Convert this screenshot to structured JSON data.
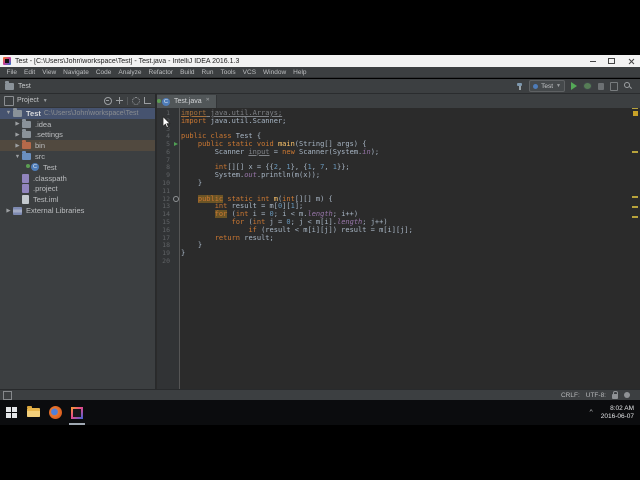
{
  "window": {
    "title": "Test - [C:\\Users\\John\\workspace\\Test] - Test.java - IntelliJ IDEA 2016.1.3"
  },
  "menu": {
    "items": [
      "File",
      "Edit",
      "View",
      "Navigate",
      "Code",
      "Analyze",
      "Refactor",
      "Build",
      "Run",
      "Tools",
      "VCS",
      "Window",
      "Help"
    ]
  },
  "navbar": {
    "breadcrumb": "Test",
    "run_config": "Test"
  },
  "project_panel": {
    "title": "Project",
    "items": [
      {
        "arrow": "expanded",
        "icon": "folder",
        "label": "Test",
        "path": "C:\\Users\\John\\workspace\\Test",
        "indent": 0,
        "selected": true,
        "bold": true
      },
      {
        "arrow": "collapsed",
        "icon": "folder",
        "label": ".idea",
        "indent": 1
      },
      {
        "arrow": "collapsed",
        "icon": "folder",
        "label": ".settings",
        "indent": 1
      },
      {
        "arrow": "collapsed",
        "icon": "folder-excluded",
        "label": "bin",
        "indent": 1,
        "tinted": true
      },
      {
        "arrow": "expanded",
        "icon": "folder-src",
        "label": "src",
        "indent": 1
      },
      {
        "arrow": null,
        "icon": "class",
        "label": "Test",
        "indent": 2
      },
      {
        "arrow": null,
        "icon": "file",
        "label": ".classpath",
        "indent": 1
      },
      {
        "arrow": null,
        "icon": "file",
        "label": ".project",
        "indent": 1
      },
      {
        "arrow": null,
        "icon": "file-iml",
        "label": "Test.iml",
        "indent": 1
      },
      {
        "arrow": "collapsed",
        "icon": "library",
        "label": "External Libraries",
        "indent": 0
      }
    ]
  },
  "editor": {
    "tab_label": "Test.java",
    "lines": [
      {
        "n": 1,
        "s": [
          {
            "c": "ku",
            "t": "import"
          },
          {
            "c": "u",
            "t": " java.util.Arrays;"
          }
        ]
      },
      {
        "n": 2,
        "s": [
          {
            "c": "k",
            "t": "import"
          },
          {
            "c": "p",
            "t": " java.util.Scanner;"
          }
        ]
      },
      {
        "n": 3,
        "s": []
      },
      {
        "n": 4,
        "s": [
          {
            "c": "k",
            "t": "public class"
          },
          {
            "c": "p",
            "t": " Test {"
          }
        ]
      },
      {
        "n": 5,
        "g": "run",
        "s": [
          {
            "c": "p",
            "t": "    "
          },
          {
            "c": "k",
            "t": "public static void"
          },
          {
            "c": "p",
            "t": " "
          },
          {
            "c": "d",
            "t": "main"
          },
          {
            "c": "p",
            "t": "(String[] args) {"
          }
        ]
      },
      {
        "n": 6,
        "s": [
          {
            "c": "p",
            "t": "        Scanner "
          },
          {
            "c": "u",
            "t": "input"
          },
          {
            "c": "p",
            "t": " = "
          },
          {
            "c": "k",
            "t": "new"
          },
          {
            "c": "p",
            "t": " Scanner(System."
          },
          {
            "c": "f",
            "t": "in"
          },
          {
            "c": "p",
            "t": ");"
          }
        ]
      },
      {
        "n": 7,
        "s": []
      },
      {
        "n": 8,
        "s": [
          {
            "c": "p",
            "t": "        "
          },
          {
            "c": "k",
            "t": "int"
          },
          {
            "c": "p",
            "t": "[][] x = {{"
          },
          {
            "c": "n",
            "t": "2"
          },
          {
            "c": "p",
            "t": ", "
          },
          {
            "c": "n",
            "t": "1"
          },
          {
            "c": "p",
            "t": "}, {"
          },
          {
            "c": "n",
            "t": "1"
          },
          {
            "c": "p",
            "t": ", "
          },
          {
            "c": "n",
            "t": "7"
          },
          {
            "c": "p",
            "t": ", "
          },
          {
            "c": "n",
            "t": "1"
          },
          {
            "c": "p",
            "t": "}};"
          }
        ]
      },
      {
        "n": 9,
        "s": [
          {
            "c": "p",
            "t": "        System."
          },
          {
            "c": "f",
            "t": "out"
          },
          {
            "c": "p",
            "t": ".println(m(x));"
          }
        ]
      },
      {
        "n": 10,
        "s": [
          {
            "c": "p",
            "t": "    }"
          }
        ]
      },
      {
        "n": 11,
        "s": []
      },
      {
        "n": 12,
        "g": "target",
        "s": [
          {
            "c": "p",
            "t": "    "
          },
          {
            "c": "khl",
            "t": "public"
          },
          {
            "c": "k",
            "t": " static int "
          },
          {
            "c": "d",
            "t": "m"
          },
          {
            "c": "p",
            "t": "("
          },
          {
            "c": "k",
            "t": "int"
          },
          {
            "c": "p",
            "t": "[][] m) {"
          }
        ]
      },
      {
        "n": 13,
        "s": [
          {
            "c": "p",
            "t": "        "
          },
          {
            "c": "k",
            "t": "int"
          },
          {
            "c": "p",
            "t": " result = m["
          },
          {
            "c": "n",
            "t": "0"
          },
          {
            "c": "p",
            "t": "]["
          },
          {
            "c": "n",
            "t": "1"
          },
          {
            "c": "p",
            "t": "];"
          }
        ]
      },
      {
        "n": 14,
        "s": [
          {
            "c": "p",
            "t": "        "
          },
          {
            "c": "khl",
            "t": "for"
          },
          {
            "c": "p",
            "t": " ("
          },
          {
            "c": "k",
            "t": "int"
          },
          {
            "c": "p",
            "t": " i = "
          },
          {
            "c": "n",
            "t": "0"
          },
          {
            "c": "p",
            "t": "; i < m."
          },
          {
            "c": "f",
            "t": "length"
          },
          {
            "c": "p",
            "t": "; i++)"
          }
        ]
      },
      {
        "n": 15,
        "s": [
          {
            "c": "p",
            "t": "            "
          },
          {
            "c": "k",
            "t": "for"
          },
          {
            "c": "p",
            "t": " ("
          },
          {
            "c": "k",
            "t": "int"
          },
          {
            "c": "p",
            "t": " j = "
          },
          {
            "c": "n",
            "t": "0"
          },
          {
            "c": "p",
            "t": "; j < m[i]."
          },
          {
            "c": "f",
            "t": "length"
          },
          {
            "c": "p",
            "t": "; j++)"
          }
        ]
      },
      {
        "n": 16,
        "s": [
          {
            "c": "p",
            "t": "                "
          },
          {
            "c": "k",
            "t": "if"
          },
          {
            "c": "p",
            "t": " (result < m[i][j]) result = m[i][j];"
          }
        ]
      },
      {
        "n": 17,
        "s": [
          {
            "c": "p",
            "t": "        "
          },
          {
            "c": "k",
            "t": "return"
          },
          {
            "c": "p",
            "t": " result;"
          }
        ]
      },
      {
        "n": 18,
        "s": [
          {
            "c": "p",
            "t": "    }"
          }
        ]
      },
      {
        "n": 19,
        "s": [
          {
            "c": "p",
            "t": "}"
          }
        ]
      },
      {
        "n": 20,
        "s": []
      }
    ]
  },
  "status_bar": {
    "line_ending": "CRLF:",
    "encoding": "UTF-8:"
  },
  "taskbar": {
    "time": "8:02 AM",
    "date": "2016-06-07",
    "tray_expand": "^"
  }
}
